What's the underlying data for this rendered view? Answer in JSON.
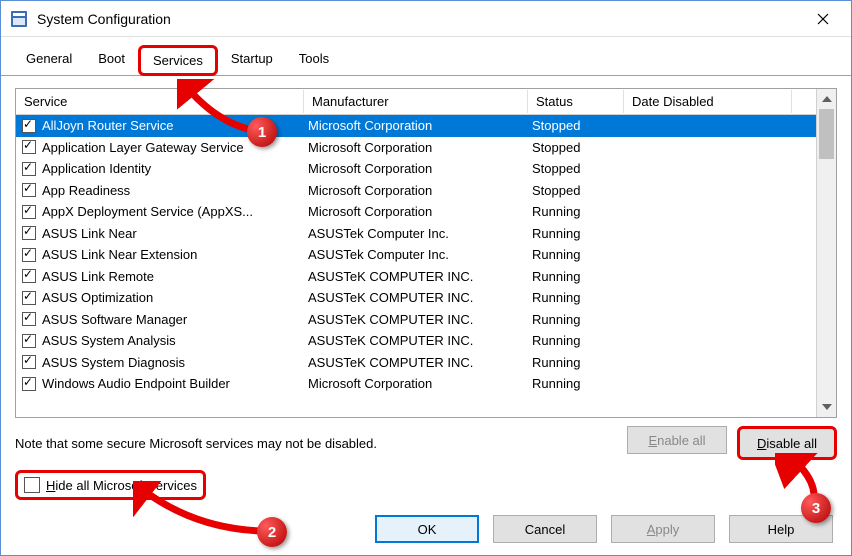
{
  "window": {
    "title": "System Configuration"
  },
  "tabs": [
    "General",
    "Boot",
    "Services",
    "Startup",
    "Tools"
  ],
  "active_tab": 2,
  "columns": {
    "service": "Service",
    "manufacturer": "Manufacturer",
    "status": "Status",
    "date_disabled": "Date Disabled"
  },
  "services": [
    {
      "checked": true,
      "name": "AllJoyn Router Service",
      "manufacturer": "Microsoft Corporation",
      "status": "Stopped",
      "selected": true
    },
    {
      "checked": true,
      "name": "Application Layer Gateway Service",
      "manufacturer": "Microsoft Corporation",
      "status": "Stopped"
    },
    {
      "checked": true,
      "name": "Application Identity",
      "manufacturer": "Microsoft Corporation",
      "status": "Stopped"
    },
    {
      "checked": true,
      "name": "App Readiness",
      "manufacturer": "Microsoft Corporation",
      "status": "Stopped"
    },
    {
      "checked": true,
      "name": "AppX Deployment Service (AppXS...",
      "manufacturer": "Microsoft Corporation",
      "status": "Running"
    },
    {
      "checked": true,
      "name": "ASUS Link Near",
      "manufacturer": "ASUSTek Computer Inc.",
      "status": "Running"
    },
    {
      "checked": true,
      "name": "ASUS Link Near Extension",
      "manufacturer": "ASUSTek Computer Inc.",
      "status": "Running"
    },
    {
      "checked": true,
      "name": "ASUS Link Remote",
      "manufacturer": "ASUSTeK COMPUTER INC.",
      "status": "Running"
    },
    {
      "checked": true,
      "name": "ASUS Optimization",
      "manufacturer": "ASUSTeK COMPUTER INC.",
      "status": "Running"
    },
    {
      "checked": true,
      "name": "ASUS Software Manager",
      "manufacturer": "ASUSTeK COMPUTER INC.",
      "status": "Running"
    },
    {
      "checked": true,
      "name": "ASUS System Analysis",
      "manufacturer": "ASUSTeK COMPUTER INC.",
      "status": "Running"
    },
    {
      "checked": true,
      "name": "ASUS System Diagnosis",
      "manufacturer": "ASUSTeK COMPUTER INC.",
      "status": "Running"
    },
    {
      "checked": true,
      "name": "Windows Audio Endpoint Builder",
      "manufacturer": "Microsoft Corporation",
      "status": "Running"
    }
  ],
  "note": "Note that some secure Microsoft services may not be disabled.",
  "buttons": {
    "enable_all": "Enable all",
    "disable_all": "Disable all",
    "ok": "OK",
    "cancel": "Cancel",
    "apply": "Apply",
    "help": "Help"
  },
  "hide_checkbox": {
    "label": "Hide all Microsoft services",
    "checked": false
  },
  "callouts": {
    "1": "1",
    "2": "2",
    "3": "3"
  }
}
